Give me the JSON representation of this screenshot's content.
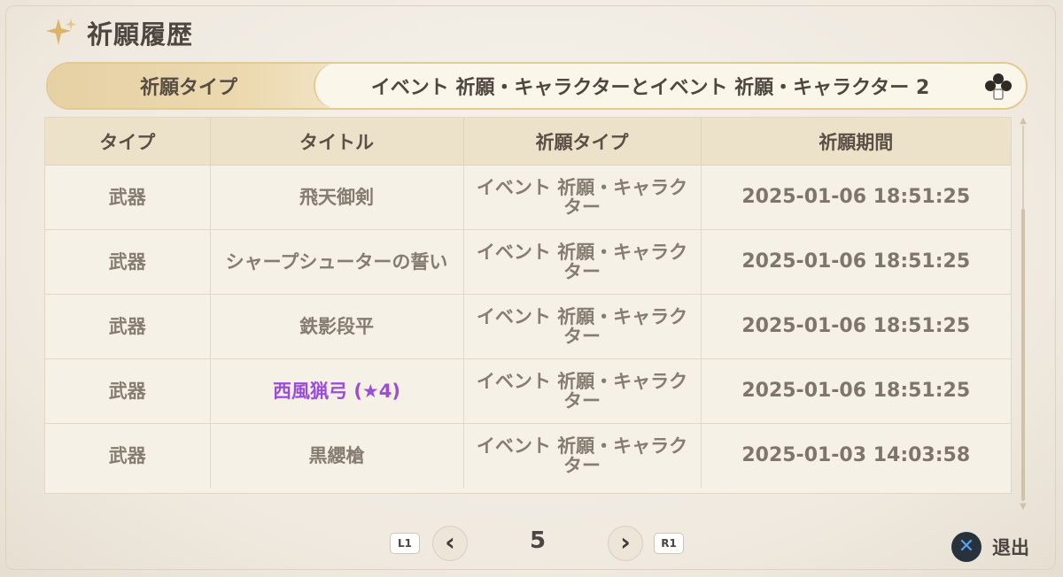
{
  "page_title": "祈願履歴",
  "wish_type_selector": {
    "label": "祈願タイプ",
    "value": "イベント 祈願・キャラクターとイベント 祈願・キャラクター 2"
  },
  "table": {
    "headers": [
      "タイプ",
      "タイトル",
      "祈願タイプ",
      "祈願期間"
    ],
    "rows": [
      {
        "type": "武器",
        "title": "飛天御剣",
        "wish_type": "イベント 祈願・キャラクター",
        "time": "2025-01-06 18:51:25",
        "rare": false
      },
      {
        "type": "武器",
        "title": "シャープシューターの誓い",
        "wish_type": "イベント 祈願・キャラクター",
        "time": "2025-01-06 18:51:25",
        "rare": false
      },
      {
        "type": "武器",
        "title": "鉄影段平",
        "wish_type": "イベント 祈願・キャラクター",
        "time": "2025-01-06 18:51:25",
        "rare": false
      },
      {
        "type": "武器",
        "title": "西風猟弓 (★4)",
        "wish_type": "イベント 祈願・キャラクター",
        "time": "2025-01-06 18:51:25",
        "rare": true
      },
      {
        "type": "武器",
        "title": "黒纓槍",
        "wish_type": "イベント 祈願・キャラクター",
        "time": "2025-01-03 14:03:58",
        "rare": false
      }
    ]
  },
  "pager": {
    "prev_key": "L1",
    "next_key": "R1",
    "current_page": "5"
  },
  "exit": {
    "label": "退出"
  },
  "colors": {
    "rare_4_star": "#9a4ed6",
    "accent_gold": "#e3c994"
  },
  "icons": {
    "title": "sparkle-star-icon",
    "switch": "gamepad-buttons-icon",
    "prev": "chevron-left-icon",
    "next": "chevron-right-icon",
    "exit": "cross-button-icon"
  }
}
